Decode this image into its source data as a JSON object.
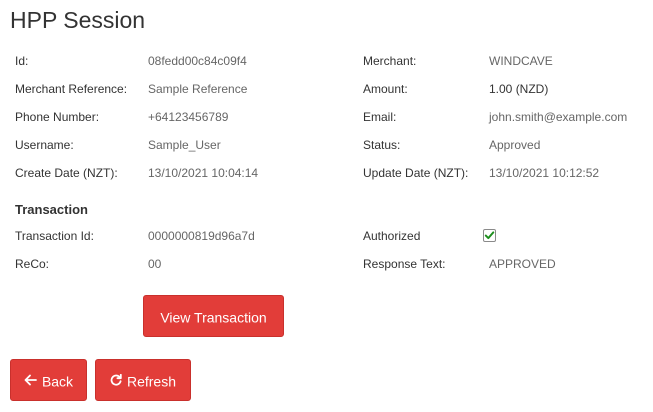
{
  "page": {
    "title": "HPP Session"
  },
  "session": {
    "id": {
      "label": "Id:",
      "value": "08fedd00c84c09f4"
    },
    "merchant": {
      "label": "Merchant:",
      "value": "WINDCAVE"
    },
    "merchant_reference": {
      "label": "Merchant Reference:",
      "value": "Sample Reference"
    },
    "amount": {
      "label": "Amount:",
      "value": "1.00 (NZD)"
    },
    "phone": {
      "label": "Phone Number:",
      "value": "+64123456789"
    },
    "email": {
      "label": "Email:",
      "value": "john.smith@example.com"
    },
    "username": {
      "label": "Username:",
      "value": "Sample_User"
    },
    "status": {
      "label": "Status:",
      "value": "Approved"
    },
    "create_date": {
      "label": "Create Date (NZT):",
      "value": "13/10/2021 10:04:14"
    },
    "update_date": {
      "label": "Update Date (NZT):",
      "value": "13/10/2021 10:12:52"
    }
  },
  "transaction": {
    "heading": "Transaction",
    "id": {
      "label": "Transaction Id:",
      "value": "0000000819d96a7d"
    },
    "authorized": {
      "label": "Authorized",
      "checked": true
    },
    "reco": {
      "label": "ReCo:",
      "value": "00"
    },
    "response_text": {
      "label": "Response Text:",
      "value": "APPROVED"
    },
    "view_button": "View Transaction"
  },
  "actions": {
    "back_label": "Back",
    "refresh_label": "Refresh",
    "back_icon": "arrow-left-icon",
    "refresh_icon": "refresh-icon"
  },
  "colors": {
    "button": "#e23d39",
    "check": "#1e8f1e"
  }
}
